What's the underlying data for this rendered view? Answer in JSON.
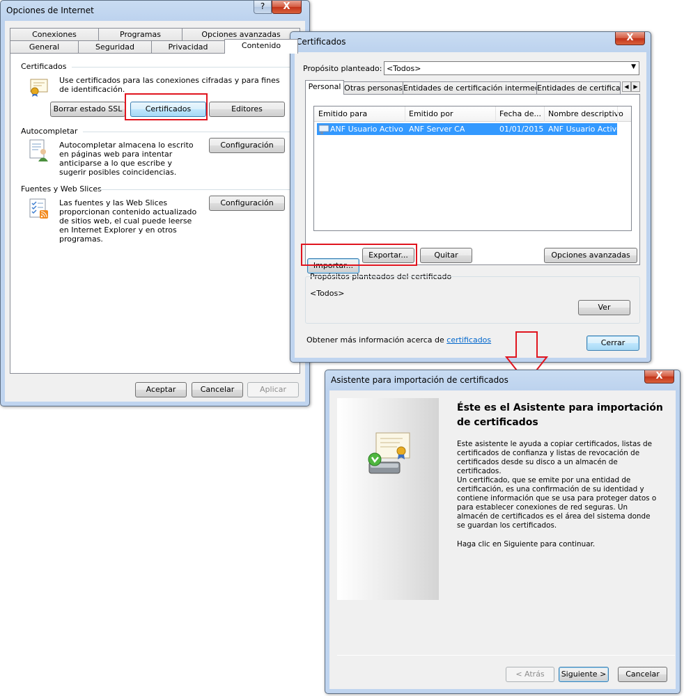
{
  "internet_options": {
    "title": "Opciones de Internet",
    "help": "?",
    "close": "X",
    "tabs_row1": [
      "Conexiones",
      "Programas",
      "Opciones avanzadas"
    ],
    "tabs_row2": [
      "General",
      "Seguridad",
      "Privacidad",
      "Contenido"
    ],
    "certificados_group": "Certificados",
    "certificados_text": "Use certificados para las conexiones cifradas y para fines de identificación.",
    "btn_borrar_ssl": "Borrar estado SSL",
    "btn_certificados": "Certificados",
    "btn_editores": "Editores",
    "autocompletar_group": "Autocompletar",
    "autocompletar_text": "Autocompletar almacena lo escrito en páginas web para intentar anticiparse a lo que escribe y sugerir posibles coincidencias.",
    "btn_config1": "Configuración",
    "fuentes_group": "Fuentes y Web Slices",
    "fuentes_text": "Las fuentes y las Web Slices proporcionan contenido actualizado de sitios web, el cual puede leerse en Internet Explorer y en otros programas.",
    "btn_config2": "Configuración",
    "btn_aceptar": "Aceptar",
    "btn_cancelar": "Cancelar",
    "btn_aplicar": "Aplicar"
  },
  "certificados": {
    "title": "Certificados",
    "close": "X",
    "proposito_label": "Propósito planteado:",
    "proposito_value": "<Todos>",
    "tabs": [
      "Personal",
      "Otras personas",
      "Entidades de certificación intermedias",
      "Entidades de certificaci"
    ],
    "columns": [
      "Emitido para",
      "Emitido por",
      "Fecha de...",
      "Nombre descriptivo"
    ],
    "rows": [
      {
        "emitido_para": "ANF Usuario Activo",
        "emitido_por": "ANF Server CA",
        "fecha": "01/01/2015",
        "nombre": "ANF Usuario Activo"
      }
    ],
    "btn_importar": "Importar...",
    "btn_exportar": "Exportar...",
    "btn_quitar": "Quitar",
    "btn_opciones_avanzadas": "Opciones avanzadas",
    "propositos_group": "Propósitos planteados del certificado",
    "propositos_value": "<Todos>",
    "btn_ver": "Ver",
    "info_text": "Obtener más información acerca de",
    "info_link": "certificados",
    "btn_cerrar": "Cerrar"
  },
  "asistente": {
    "title": "Asistente para importación de certificados",
    "close": "X",
    "heading": "Éste es el Asistente para importación de certificados",
    "para1": "Este asistente le ayuda a copiar certificados, listas de certificados de confianza y listas de revocación de certificados desde su disco a un almacén de certificados.",
    "para2": "Un certificado, que se emite por una entidad de certificación, es una confirmación de su identidad y contiene información que se usa para proteger datos o para establecer conexiones de red seguras. Un almacén de certificados es el área del sistema donde se guardan los certificados.",
    "para3": "Haga clic en Siguiente para continuar.",
    "btn_atras": "< Atrás",
    "btn_siguiente": "Siguiente >",
    "btn_cancelar": "Cancelar"
  },
  "colors": {
    "highlight_red": "#e0141e",
    "selection_blue": "#3399ff",
    "link_blue": "#0066cc"
  }
}
